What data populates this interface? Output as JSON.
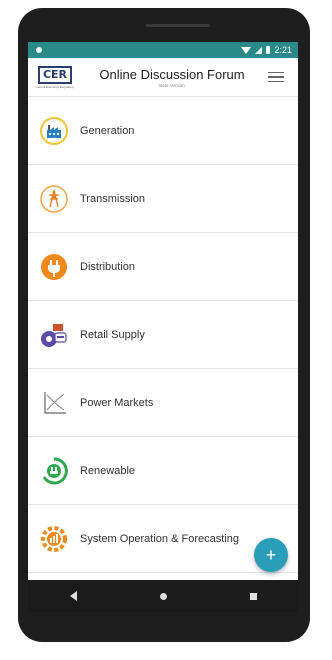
{
  "statusbar": {
    "time": "2:21"
  },
  "appbar": {
    "logo_text": "CER",
    "logo_sub": "Central Electricity Regulatory",
    "title": "Online Discussion Forum",
    "subtitle": "Beta Version"
  },
  "categories": [
    {
      "label": "Generation",
      "icon": "factory-icon",
      "color": "#f2c23a"
    },
    {
      "label": "Transmission",
      "icon": "transmission-tower-icon",
      "color": "#f4a34b"
    },
    {
      "label": "Distribution",
      "icon": "plug-icon",
      "color": "#f08a1c"
    },
    {
      "label": "Retail Supply",
      "icon": "retail-supply-icon",
      "color": "#5b4aa6"
    },
    {
      "label": "Power Markets",
      "icon": "supply-demand-graph-icon",
      "color": "#7a7a7a"
    },
    {
      "label": "Renewable",
      "icon": "renewable-plug-icon",
      "color": "#2fa84f"
    },
    {
      "label": "System Operation & Forecasting",
      "icon": "gear-chart-icon",
      "color": "#f08a1c"
    }
  ],
  "fab": {
    "label": "+"
  }
}
